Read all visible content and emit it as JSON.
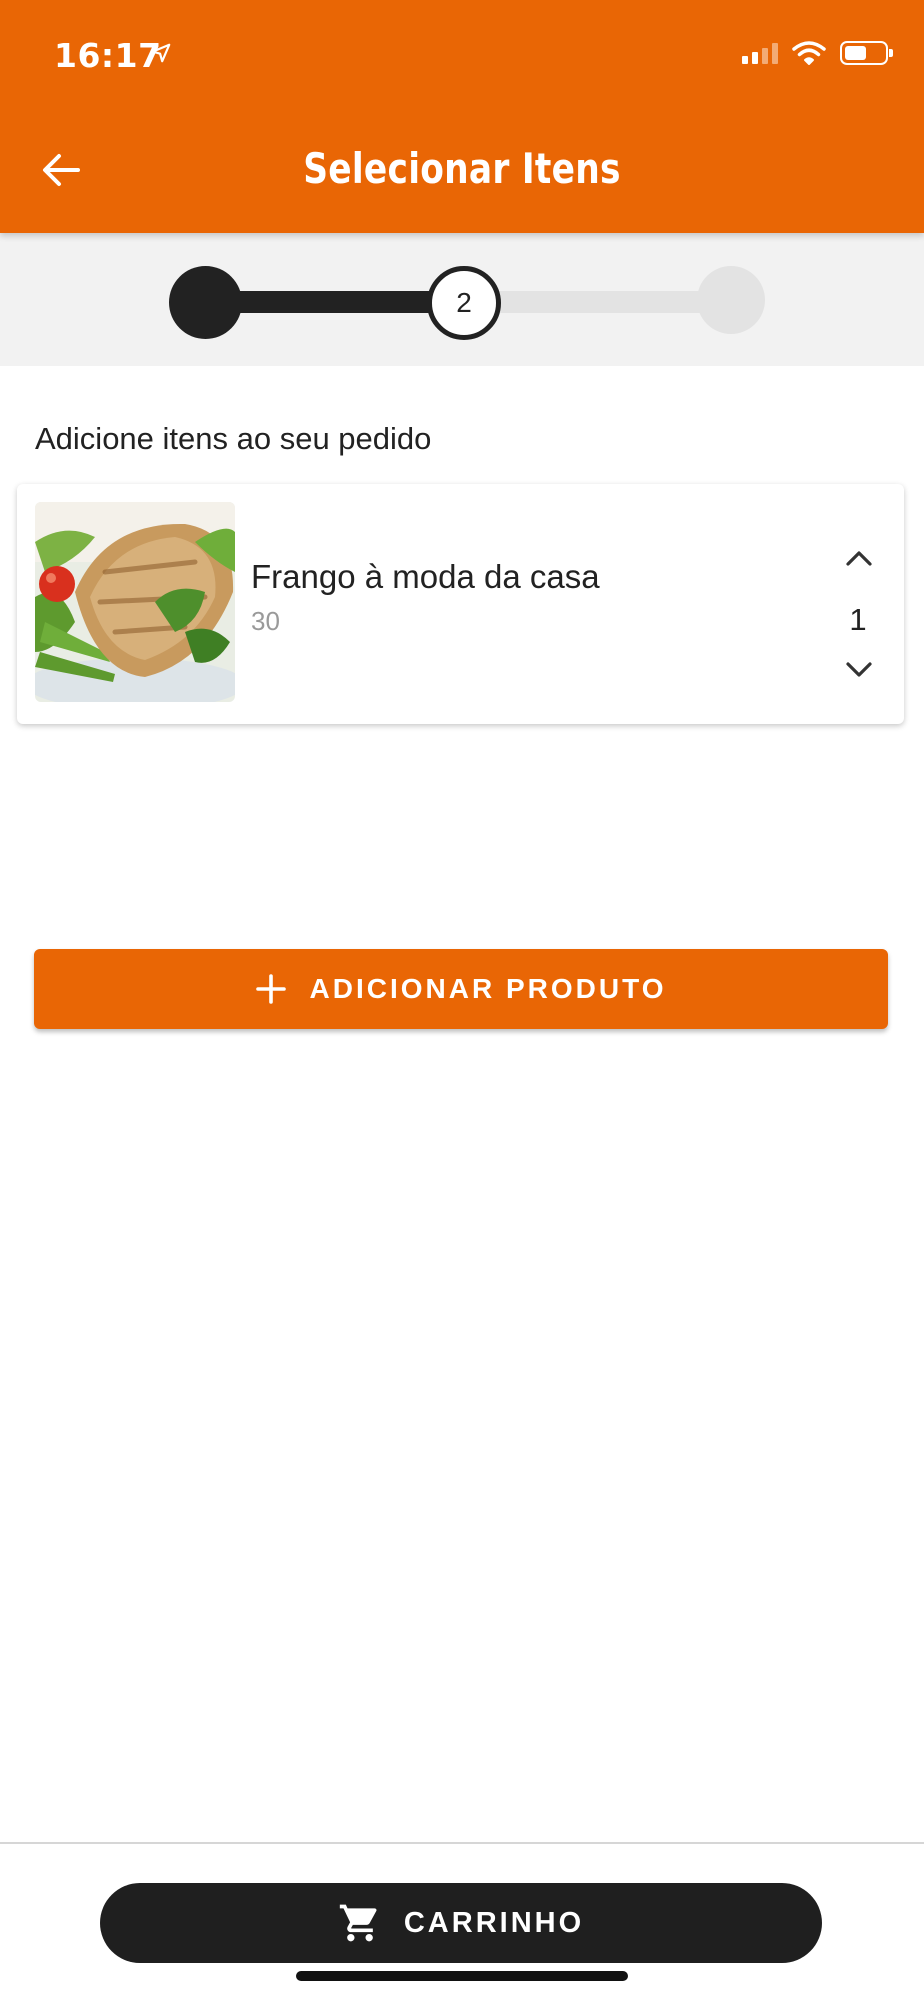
{
  "status_bar": {
    "time": "16:17",
    "location_icon": "location-arrow-icon",
    "signal_icon": "cellular-signal-icon",
    "wifi_icon": "wifi-icon",
    "battery_icon": "battery-icon",
    "battery_level": 0.55
  },
  "header": {
    "title": "Selecionar Itens",
    "back_icon": "arrow-left-icon",
    "background": "#E96605"
  },
  "stepper": {
    "current_step_label": "2",
    "current_step": 2,
    "total_steps": 3
  },
  "content": {
    "section_label": "Adicione itens ao seu pedido",
    "items": [
      {
        "name": "Frango à moda da casa",
        "subtitle": "30",
        "quantity": "1",
        "image": "grilled-chicken-salad-photo",
        "increase_icon": "chevron-up-icon",
        "decrease_icon": "chevron-down-icon"
      }
    ],
    "add_button": {
      "icon": "plus-icon",
      "label": "ADICIONAR PRODUTO"
    }
  },
  "footer": {
    "cart_button": {
      "icon": "shopping-cart-icon",
      "label": "CARRINHO"
    }
  },
  "colors": {
    "accent": "#E96605",
    "dark": "#1F1F1F",
    "muted_text": "#9A9A9A"
  }
}
